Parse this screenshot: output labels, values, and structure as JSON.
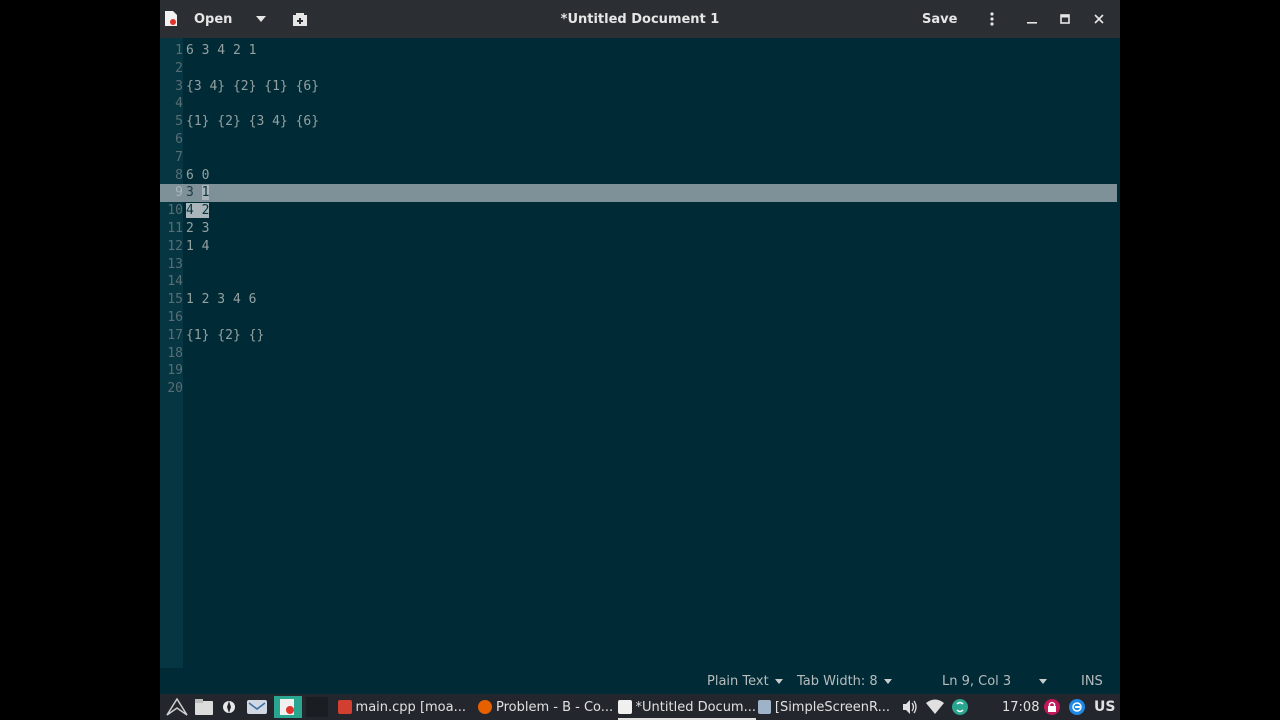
{
  "app": {
    "open_label": "Open",
    "title": "*Untitled Document 1",
    "save_label": "Save"
  },
  "editor": {
    "lines": [
      {
        "num": "1",
        "text": "6 3 4 2 1"
      },
      {
        "num": "2",
        "text": ""
      },
      {
        "num": "3",
        "text": "{3 4} {2} {1} {6}"
      },
      {
        "num": "4",
        "text": ""
      },
      {
        "num": "5",
        "text": "{1} {2} {3 4} {6}"
      },
      {
        "num": "6",
        "text": ""
      },
      {
        "num": "7",
        "text": ""
      },
      {
        "num": "8",
        "text": "6 0"
      },
      {
        "num": "9",
        "text_a": "3 ",
        "text_sel": "1",
        "current": true
      },
      {
        "num": "10",
        "text_sel": "4 2"
      },
      {
        "num": "11",
        "text": "2 3"
      },
      {
        "num": "12",
        "text": "1 4"
      },
      {
        "num": "13",
        "text": ""
      },
      {
        "num": "14",
        "text": ""
      },
      {
        "num": "15",
        "text": "1 2 3 4 6"
      },
      {
        "num": "16",
        "text": ""
      },
      {
        "num": "17",
        "text": "{1} {2} {}"
      },
      {
        "num": "18",
        "text": ""
      },
      {
        "num": "19",
        "text": ""
      },
      {
        "num": "20",
        "text": ""
      }
    ]
  },
  "status": {
    "language": "Plain Text",
    "tab_width": "Tab Width: 8",
    "position": "Ln 9, Col 3",
    "mode": "INS"
  },
  "taskbar": {
    "tasks": [
      {
        "label": "main.cpp [moa...",
        "icon": "code-editor-icon"
      },
      {
        "label": "Problem - B - Co...",
        "icon": "firefox-icon"
      },
      {
        "label": "*Untitled Docum...",
        "icon": "text-editor-icon",
        "active": true
      },
      {
        "label": "[SimpleScreenR...",
        "icon": "screen-recorder-icon"
      }
    ],
    "clock": "17:08",
    "keyboard_layout": "US"
  },
  "colors": {
    "editor_bg": "#002b36",
    "gutter_bg": "#063642",
    "text": "#93a1a1",
    "current_line": "#7e9198",
    "headerbar": "#2b2e33",
    "taskbar": "#23272d"
  }
}
